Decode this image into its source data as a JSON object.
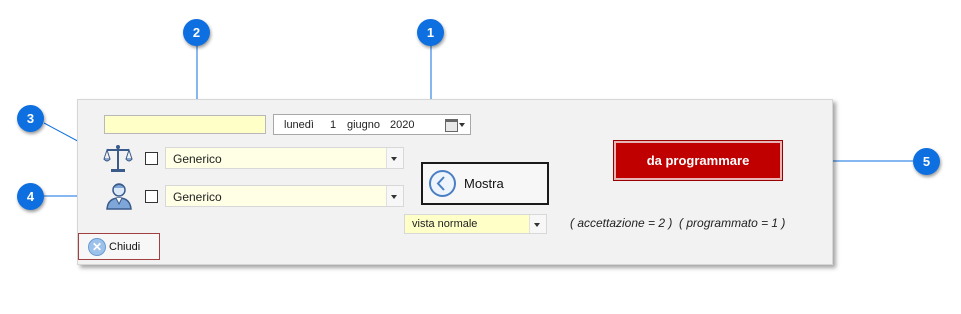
{
  "form": {
    "yellow_field_value": "",
    "date": {
      "weekday": "lunedì",
      "day": "1",
      "month": "giugno",
      "year": "2020"
    },
    "filter1": {
      "icon": "scales-icon",
      "checked": false,
      "value": "Generico"
    },
    "filter2": {
      "icon": "user-icon",
      "checked": false,
      "value": "Generico"
    },
    "mostra_label": "Mostra",
    "view_select": "vista normale",
    "programmare_label": "da programmare",
    "status_text": "( accettazione = 2 )  ( programmato = 1 )",
    "chiudi_label": "Chiudi"
  },
  "callouts": [
    "1",
    "2",
    "3",
    "4",
    "5"
  ],
  "colors": {
    "callout": "#0e6fe0",
    "primary_button": "#c00000",
    "field_yellow": "#ffffc8"
  }
}
